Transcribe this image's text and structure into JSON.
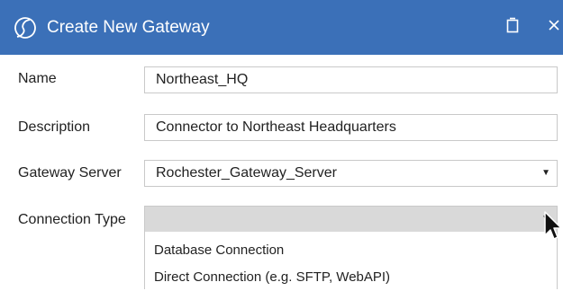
{
  "dialog": {
    "title": "Create New Gateway",
    "logo_icon": "s-script-logo-icon",
    "restore_icon": "restore-icon",
    "close_icon": "close-icon",
    "title_bar_color": "#3b70b8"
  },
  "form": {
    "name_label": "Name",
    "name_value": "Northeast_HQ",
    "description_label": "Description",
    "description_value": "Connector to Northeast Headquarters",
    "gateway_server_label": "Gateway Server",
    "gateway_server_value": "Rochester_Gateway_Server",
    "connection_type_label": "Connection Type",
    "connection_type_value": "",
    "dropdown_arrow": "▼"
  },
  "connection_type_options": [
    "Database Connection",
    "Direct Connection (e.g. SFTP, WebAPI)"
  ]
}
